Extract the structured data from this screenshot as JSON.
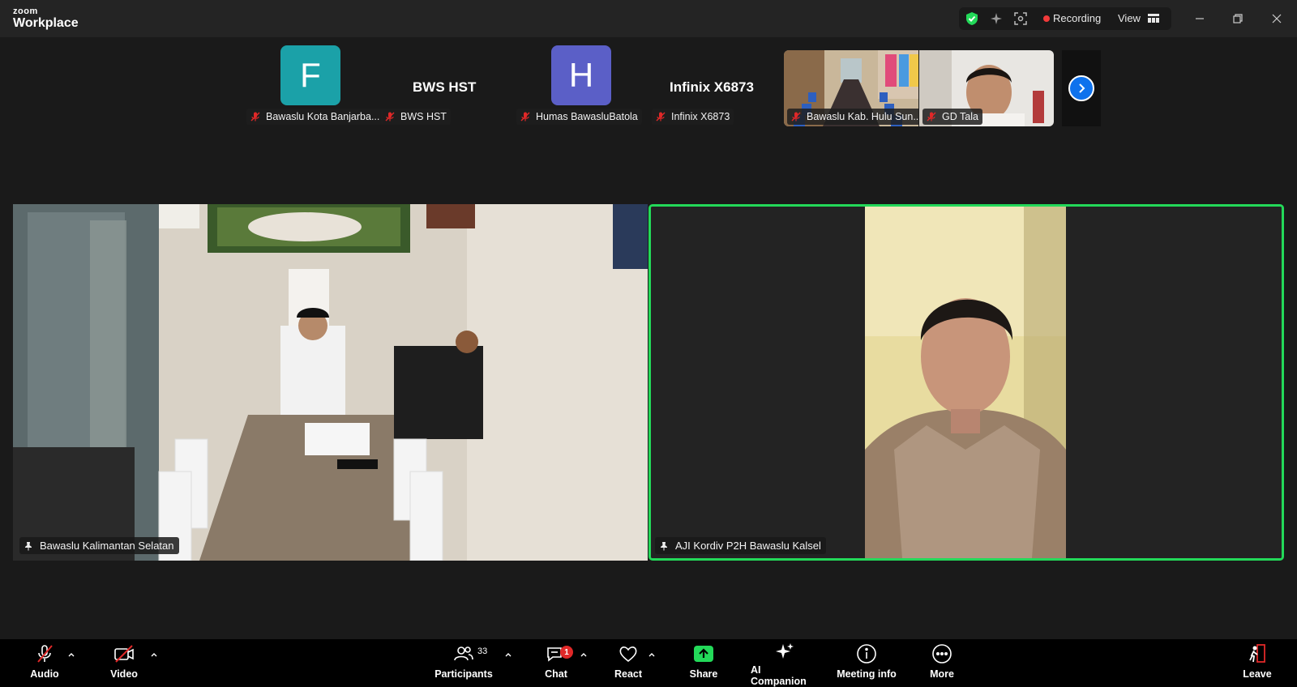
{
  "app": {
    "logo_small": "zoom",
    "logo_big": "Workplace"
  },
  "status_bar": {
    "recording_label": "Recording",
    "view_label": "View",
    "shield_color": "#23d959",
    "recording_color": "#f23a3a"
  },
  "thumbnails": [
    {
      "type": "avatar",
      "initial": "F",
      "color": "#1ba1a8",
      "name": "Bawaslu Kota Banjarba...",
      "muted": true
    },
    {
      "type": "name",
      "display": "BWS HST",
      "name": "BWS HST",
      "muted": true
    },
    {
      "type": "avatar",
      "initial": "H",
      "color": "#5b5fc7",
      "name": "Humas BawasluBatola",
      "muted": true
    },
    {
      "type": "name",
      "display": "Infinix X6873",
      "name": "Infinix X6873",
      "muted": true
    },
    {
      "type": "video",
      "name": "Bawaslu Kab. Hulu Sun...",
      "muted": true
    },
    {
      "type": "video",
      "name": "GD Tala",
      "muted": true
    }
  ],
  "main_videos": [
    {
      "name": "Bawaslu Kalimantan Selatan",
      "pinned": true,
      "active_speaker": false
    },
    {
      "name": "AJI Kordiv P2H Bawaslu Kalsel",
      "pinned": true,
      "active_speaker": true
    }
  ],
  "toolbar": {
    "audio": "Audio",
    "video": "Video",
    "participants": "Participants",
    "participants_count": "33",
    "chat": "Chat",
    "chat_badge": "1",
    "react": "React",
    "share": "Share",
    "ai_companion": "AI Companion",
    "meeting_info": "Meeting info",
    "more": "More",
    "leave": "Leave",
    "share_color": "#23d959",
    "leave_color": "#e02828"
  }
}
